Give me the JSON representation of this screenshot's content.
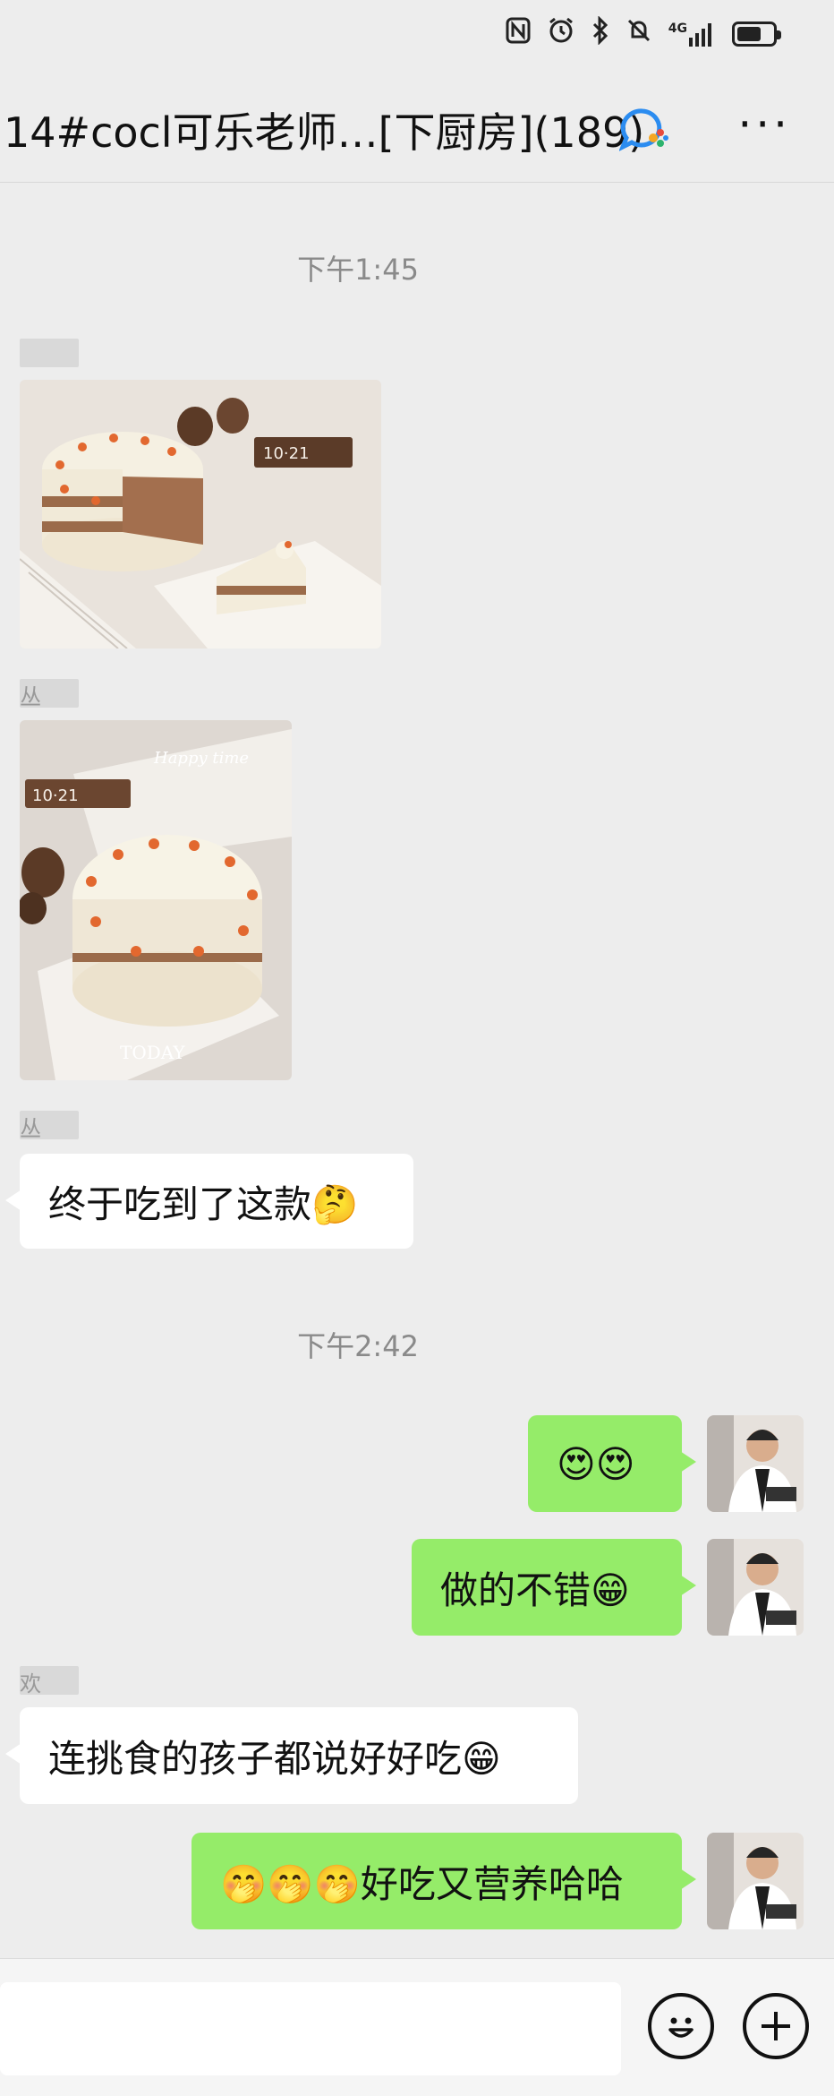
{
  "status_bar": {
    "network_label": "4G"
  },
  "header": {
    "title": "14#cocl可乐老师…[下厨房](189)",
    "more_label": "···"
  },
  "messages": {
    "time_1": "下午1:45",
    "text_1": "终于吃到了这款🤔",
    "time_2": "下午2:42",
    "text_2": "😍😍",
    "text_3": "做的不错😁",
    "text_4": "连挑食的孩子都说好好吃😁",
    "text_5": "🤭🤭🤭好吃又营养哈哈",
    "sender_2": "丛",
    "sender_3": "丛",
    "sender_4": "欢"
  },
  "photos": {
    "photo_1_label": "10·21",
    "photo_2_top": "Happy time",
    "photo_2_label": "10·21",
    "photo_2_caption": "TODAY"
  },
  "input": {
    "placeholder": ""
  },
  "colors": {
    "background": "#ededed",
    "my_bubble": "#95ec69",
    "their_bubble": "#ffffff",
    "timestamp": "#8a8a8a"
  },
  "icons": {
    "emoji_button": "smile-icon",
    "more_button": "plus-circle-icon"
  }
}
